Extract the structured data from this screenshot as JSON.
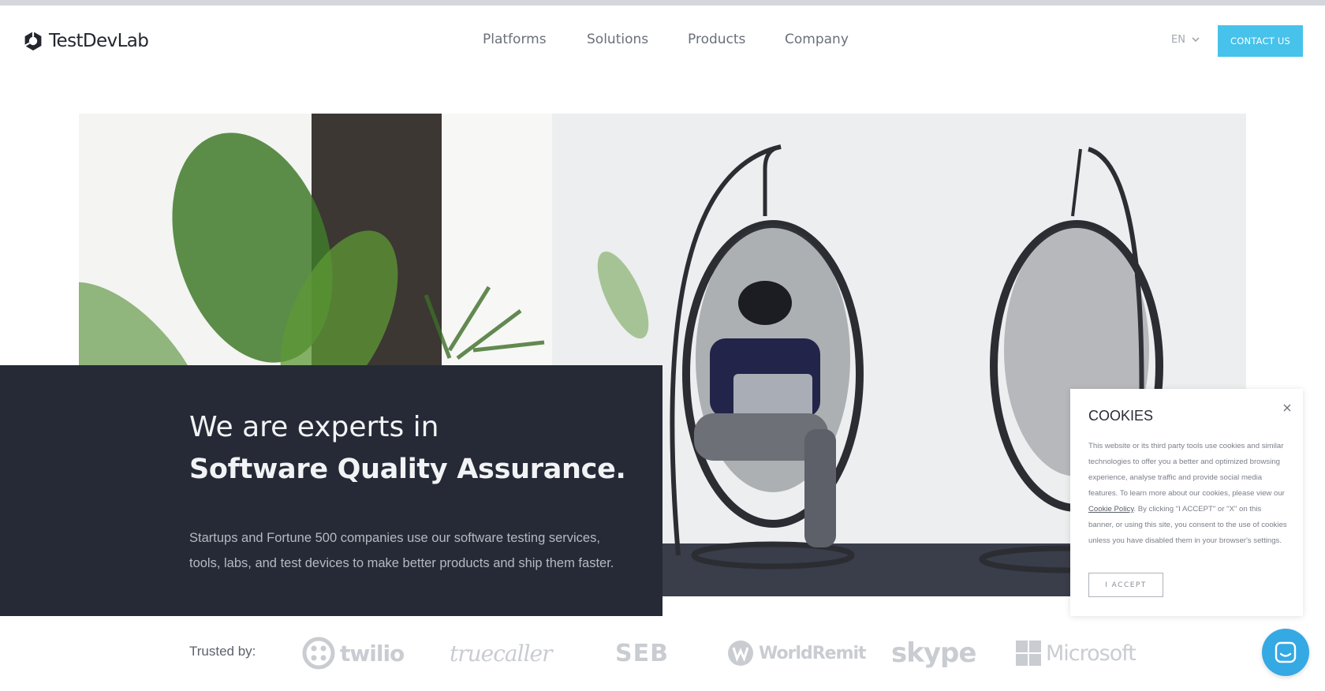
{
  "header": {
    "logo_text": "TestDevLab",
    "nav": [
      {
        "label": "Platforms"
      },
      {
        "label": "Solutions"
      },
      {
        "label": "Products"
      },
      {
        "label": "Company"
      }
    ],
    "language": "EN",
    "contact_label": "CONTACT US"
  },
  "hero": {
    "title_line1": "We are experts in",
    "title_line2": "Software Quality Assurance.",
    "subtitle": "Startups and Fortune 500 companies use our software testing services, tools, labs, and test devices to make better products and ship them faster."
  },
  "trusted": {
    "label": "Trusted by:",
    "clients": [
      "twilio",
      "truecaller",
      "SEB",
      "WorldRemit",
      "skype",
      "Microsoft"
    ]
  },
  "cookies": {
    "title": "COOKIES",
    "text_before_link": "This website or its third party tools use cookies and similar technologies to offer you a better and optimized browsing experience, analyse traffic and provide social media features. To learn more about our cookies, please view our ",
    "link_label": "Cookie Policy",
    "text_after_link": ". By clicking \"I ACCEPT\" or \"X\" on this banner, or using this site, you consent to the use of cookies unless you have disabled them in your browser's settings.",
    "accept_label": "I ACCEPT"
  },
  "colors": {
    "accent": "#47c2ea",
    "panel": "#252a36",
    "chat": "#34a9e4"
  },
  "icons": {
    "logo": "testdevlab-logo-icon",
    "language_caret": "chevron-down-icon",
    "cookie_close": "close-icon",
    "chat": "chat-icon"
  }
}
